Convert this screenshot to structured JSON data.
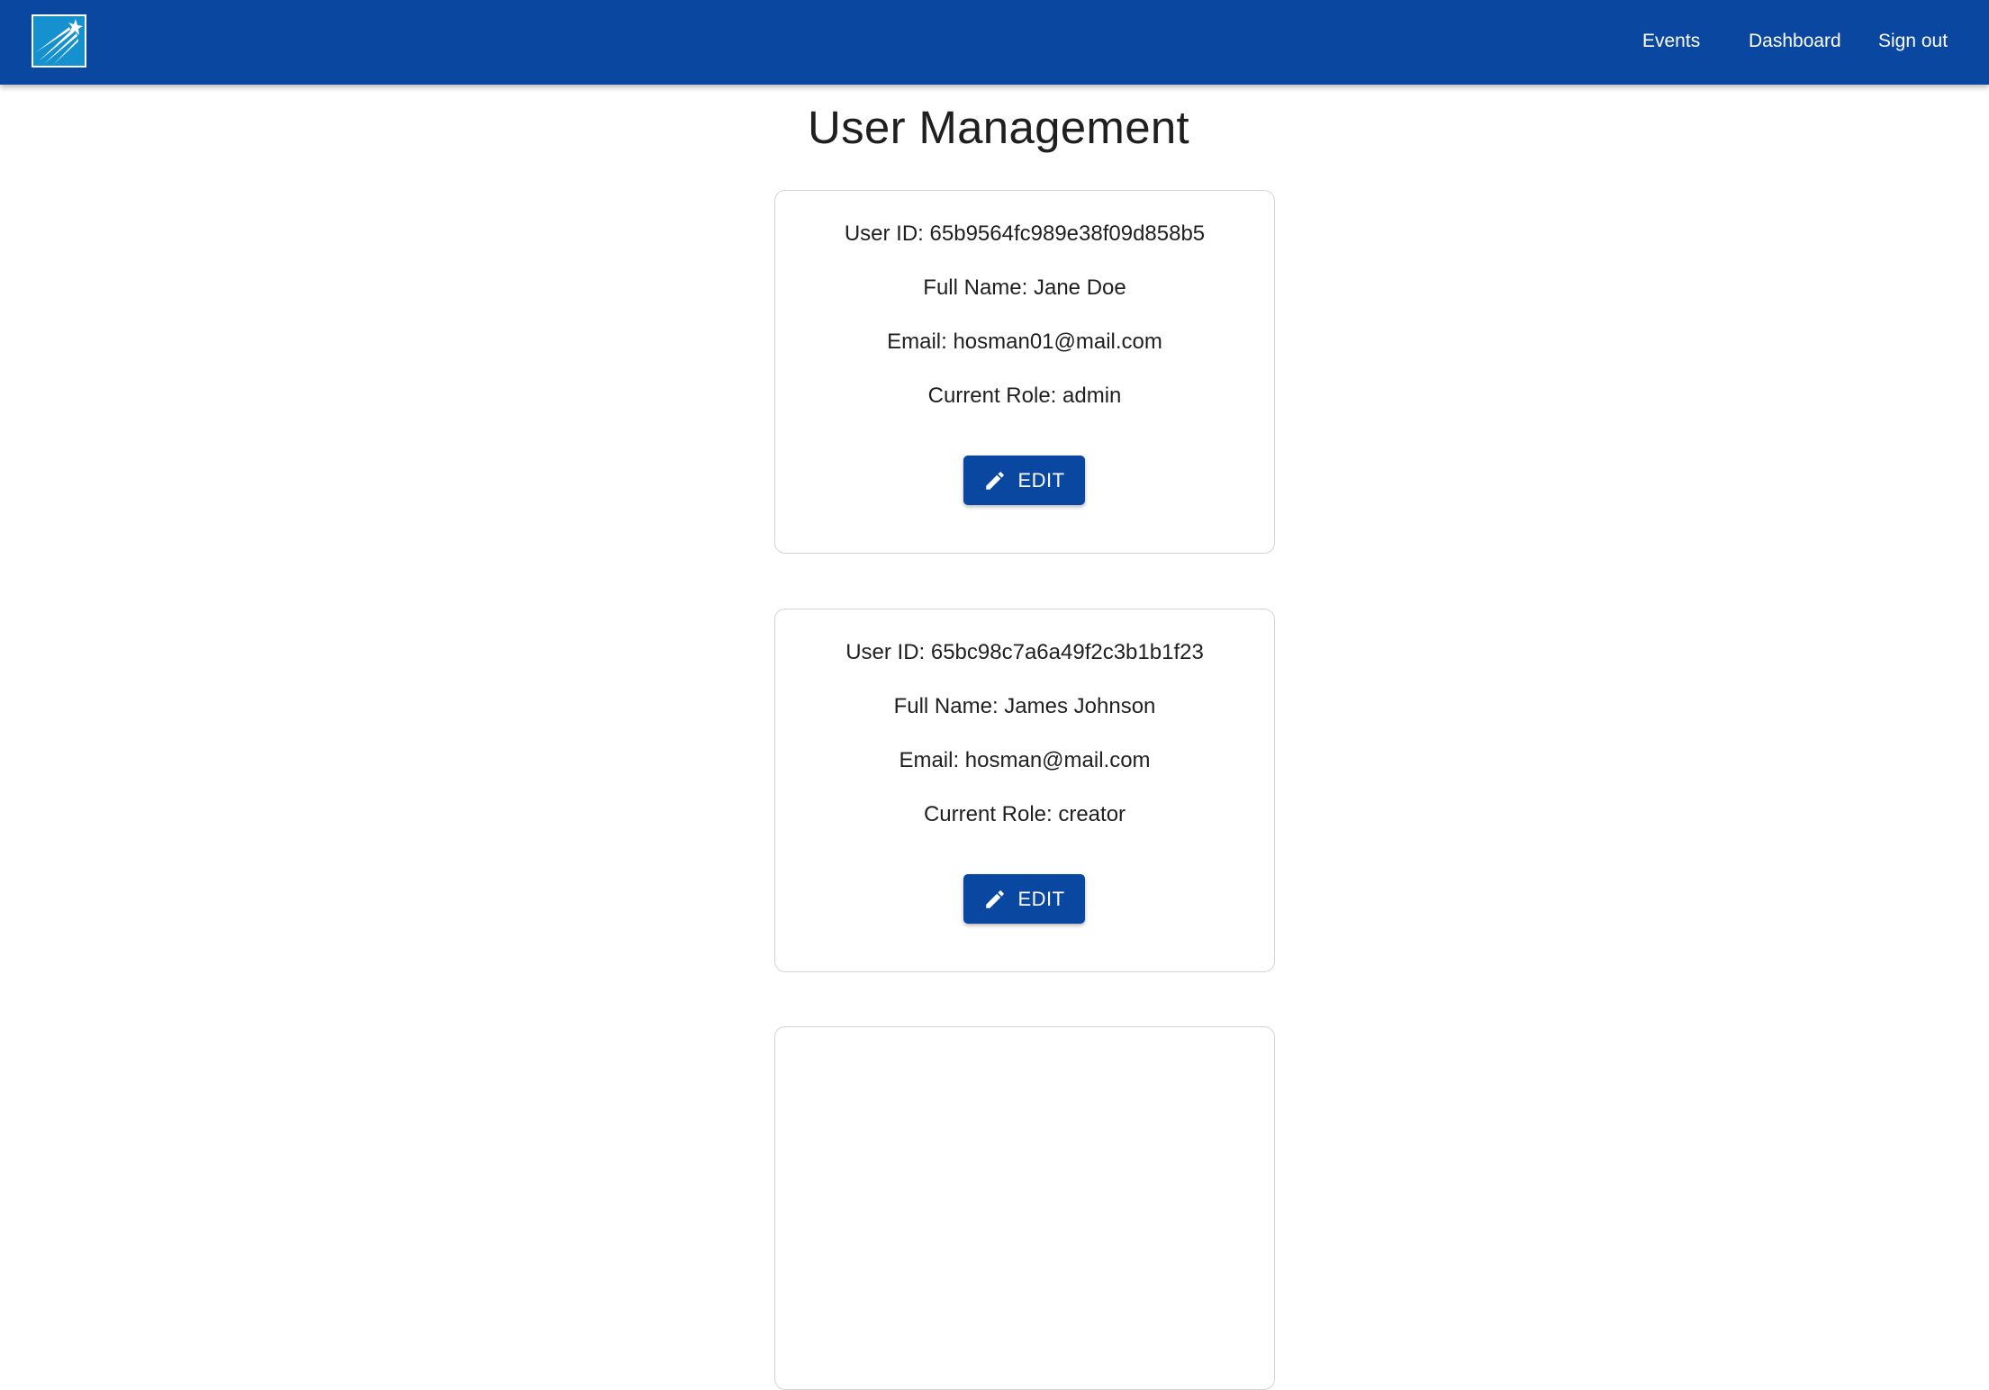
{
  "header": {
    "logo_icon": "shooting-star-logo",
    "background": "#0a47a1",
    "nav": [
      {
        "label": "Events"
      },
      {
        "label": "Dashboard"
      },
      {
        "label": "Sign out"
      }
    ]
  },
  "page": {
    "title": "User Management"
  },
  "users": [
    {
      "id_text": "User ID: 65b9564fc989e38f09d858b5",
      "name_text": "Full Name: Jane Doe",
      "email_text": "Email: hosman01@mail.com",
      "role_text": "Current Role: admin",
      "edit_label": "EDIT",
      "edit_icon": "pencil-icon"
    },
    {
      "id_text": "User ID: 65bc98c7a6a49f2c3b1b1f23",
      "name_text": "Full Name: James Johnson",
      "email_text": "Email: hosman@mail.com",
      "role_text": "Current Role: creator",
      "edit_label": "EDIT",
      "edit_icon": "pencil-icon"
    }
  ]
}
